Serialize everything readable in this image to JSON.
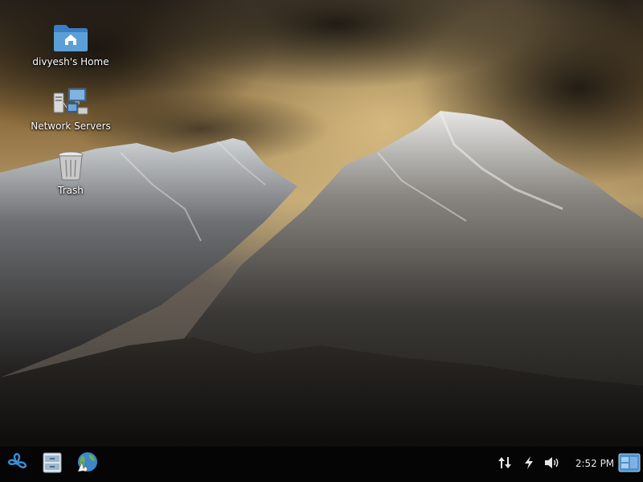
{
  "desktop": {
    "icons": [
      {
        "label": "divyesh's Home",
        "icon": "home-folder-icon"
      },
      {
        "label": "Network Servers",
        "icon": "network-servers-icon"
      },
      {
        "label": "Trash",
        "icon": "trash-icon"
      }
    ]
  },
  "taskbar": {
    "launchers": [
      {
        "icon": "start-menu-icon"
      },
      {
        "icon": "file-manager-icon"
      },
      {
        "icon": "web-browser-icon"
      }
    ],
    "tray": [
      {
        "icon": "network-transfer-icon"
      },
      {
        "icon": "power-icon"
      },
      {
        "icon": "volume-icon"
      }
    ],
    "clock": "2:52 PM",
    "show_desktop_icon": "show-desktop-icon"
  },
  "colors": {
    "taskbar_bg": "#050505",
    "folder_blue": "#5b9fd6",
    "label_text": "#ffffff"
  }
}
